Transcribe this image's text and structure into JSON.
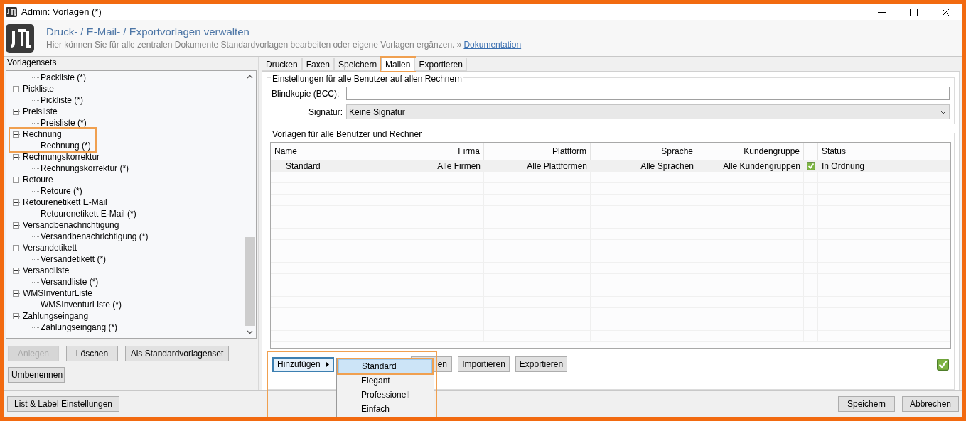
{
  "window": {
    "title": "Admin: Vorlagen (*)"
  },
  "header": {
    "title": "Druck- / E-Mail- / Exportvorlagen verwalten",
    "subtitle": "Hier können Sie für alle zentralen Dokumente Standardvorlagen bearbeiten oder eigene Vorlagen ergänzen. »",
    "link": "Dokumentation"
  },
  "left_panel": {
    "title": "Vorlagensets",
    "tree": {
      "partial_children": [
        {
          "label": "Packliste (*)"
        }
      ],
      "items": [
        {
          "label": "Pickliste",
          "expanded": true,
          "highlighted": false,
          "children": [
            {
              "label": "Pickliste (*)"
            }
          ]
        },
        {
          "label": "Preisliste",
          "expanded": true,
          "highlighted": false,
          "children": [
            {
              "label": "Preisliste (*)"
            }
          ]
        },
        {
          "label": "Rechnung",
          "expanded": true,
          "highlighted": true,
          "children": [
            {
              "label": "Rechnung (*)"
            }
          ]
        },
        {
          "label": "Rechnungskorrektur",
          "expanded": true,
          "highlighted": false,
          "children": [
            {
              "label": "Rechnungskorrektur (*)"
            }
          ]
        },
        {
          "label": "Retoure",
          "expanded": true,
          "highlighted": false,
          "children": [
            {
              "label": "Retoure (*)"
            }
          ]
        },
        {
          "label": "Retourenetikett E-Mail",
          "expanded": true,
          "highlighted": false,
          "children": [
            {
              "label": "Retourenetikett E-Mail (*)"
            }
          ]
        },
        {
          "label": "Versandbenachrichtigung",
          "expanded": true,
          "highlighted": false,
          "children": [
            {
              "label": "Versandbenachrichtigung (*)"
            }
          ]
        },
        {
          "label": "Versandetikett",
          "expanded": true,
          "highlighted": false,
          "children": [
            {
              "label": "Versandetikett (*)"
            }
          ]
        },
        {
          "label": "Versandliste",
          "expanded": true,
          "highlighted": false,
          "children": [
            {
              "label": "Versandliste (*)"
            }
          ]
        },
        {
          "label": "WMSInventurListe",
          "expanded": true,
          "highlighted": false,
          "children": [
            {
              "label": "WMSInventurListe (*)"
            }
          ]
        },
        {
          "label": "Zahlungseingang",
          "expanded": true,
          "highlighted": false,
          "children": [
            {
              "label": "Zahlungseingang (*)"
            }
          ]
        }
      ]
    },
    "buttons": [
      {
        "label": "Anlegen",
        "disabled": true
      },
      {
        "label": "Löschen",
        "disabled": false
      },
      {
        "label": "Als Standardvorlagenset",
        "disabled": false
      },
      {
        "label": "Umbenennen",
        "disabled": false
      }
    ]
  },
  "tabs": [
    {
      "label": "Drucken",
      "selected": false,
      "highlighted": false
    },
    {
      "label": "Faxen",
      "selected": false,
      "highlighted": false
    },
    {
      "label": "Speichern",
      "selected": false,
      "highlighted": false
    },
    {
      "label": "Mailen",
      "selected": true,
      "highlighted": true
    },
    {
      "label": "Exportieren",
      "selected": false,
      "highlighted": false
    }
  ],
  "settings": {
    "title": "Einstellungen für alle Benutzer auf allen Rechnern",
    "bcc_label": "Blindkopie (BCC):",
    "signature_label": "Signatur:",
    "signature_value": "Keine Signatur"
  },
  "templates": {
    "title": "Vorlagen für alle Benutzer und Rechner",
    "table": {
      "columns": [
        "Name",
        "Firma",
        "Plattform",
        "Sprache",
        "Kundengruppe",
        "Status"
      ],
      "rows": [
        {
          "cells": [
            "Standard",
            "Alle Firmen",
            "Alle Plattformen",
            "Alle Sprachen",
            "Alle Kundengruppen",
            "In Ordnung"
          ],
          "ok": true,
          "selected": true
        }
      ]
    },
    "add_button": "Hinzufügen",
    "hidden_button": "en",
    "buttons": [
      "Importieren",
      "Exportieren"
    ],
    "status_ok": true,
    "menu": {
      "highlighted": true,
      "items": [
        {
          "label": "Standard",
          "selected": true
        },
        {
          "label": "Elegant",
          "selected": false
        },
        {
          "label": "Professionell",
          "selected": false
        },
        {
          "label": "Einfach",
          "selected": false
        }
      ]
    }
  },
  "footer": {
    "left_button": "List & Label Einstellungen",
    "buttons": [
      "Speichern",
      "Abbrechen"
    ]
  }
}
